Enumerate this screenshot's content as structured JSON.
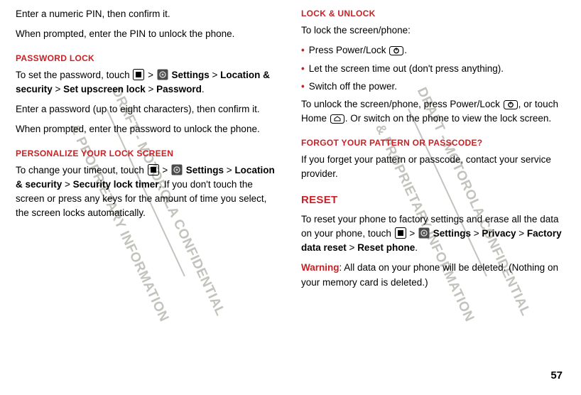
{
  "page_number": "57",
  "watermark": {
    "line1": "DRAFT - MOTOROLA CONFIDENTIAL",
    "line2": "& PROPRIETARY INFORMATION"
  },
  "left": {
    "intro_line1": "Enter a numeric PIN, then confirm it.",
    "intro_line2": "When prompted, enter the PIN to unlock the phone.",
    "section_password_lock": {
      "title": "Password lock",
      "p1_a": "To set the password, touch ",
      "p1_b": " > ",
      "p1_settings": "Settings",
      "p1_c": " > ",
      "p1_loc_sec": "Location & security",
      "p1_d": " > ",
      "p1_upscreen": "Set upscreen lock",
      "p1_e": " > ",
      "p1_password": "Password",
      "p1_f": ".",
      "p2": "Enter a password (up to eight characters), then confirm it.",
      "p3": "When prompted, enter the password to unlock the phone."
    },
    "section_personalize": {
      "title": "Personalize your lock screen",
      "p1_a": "To change your timeout, touch ",
      "p1_b": " > ",
      "p1_settings": "Settings",
      "p1_c": " > ",
      "p1_loc_sec": "Location & security",
      "p1_d": " > ",
      "p1_timer": "Security lock timer",
      "p1_e": ". If you don't touch the screen or press any keys for the amount of time you select, the screen locks automatically."
    }
  },
  "right": {
    "section_lock_unlock": {
      "title": "Lock & unlock",
      "intro": "To lock the screen/phone:",
      "b1_a": "Press Power/Lock ",
      "b1_b": ".",
      "b2": "Let the screen time out (don't press anything).",
      "b3": "Switch off the power.",
      "p2_a": "To unlock the screen/phone, press Power/Lock ",
      "p2_b": ", or touch Home ",
      "p2_c": ". Or switch on the phone to view the lock screen."
    },
    "section_forgot": {
      "title": "Forgot your pattern or passcode?",
      "p1": "If you forget your pattern or passcode, contact your service provider."
    },
    "section_reset": {
      "title": "Reset",
      "p1_a": "To reset your phone to factory settings and erase all the data on your phone, touch ",
      "p1_b": " > ",
      "p1_settings": "Settings",
      "p1_c": " > ",
      "p1_privacy": "Privacy",
      "p1_d": " > ",
      "p1_fdr": "Factory data reset",
      "p1_e": " > ",
      "p1_resetphone": "Reset phone",
      "p1_f": ".",
      "warn_label": "Warning",
      "warn_text": ": All data on your phone will be deleted. (Nothing on your memory card is deleted.)"
    }
  }
}
